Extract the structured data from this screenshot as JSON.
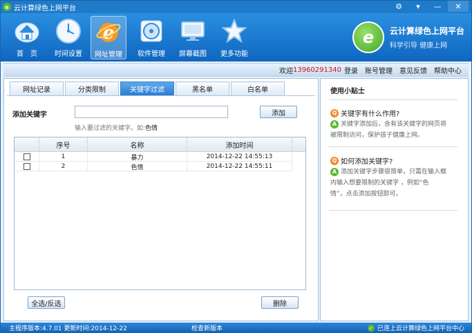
{
  "titlebar": {
    "title": "云计算绿色上网平台",
    "gear": "⚙",
    "dropdown": "▾",
    "minimize": "—",
    "close": "✕"
  },
  "toolbar": {
    "items": [
      {
        "label": "首　页",
        "icon": "home-icon"
      },
      {
        "label": "时间设置",
        "icon": "clock-icon"
      },
      {
        "label": "网址管理",
        "icon": "ie-icon"
      },
      {
        "label": "软件管理",
        "icon": "disc-icon"
      },
      {
        "label": "屏幕截图",
        "icon": "monitor-icon"
      },
      {
        "label": "更多功能",
        "icon": "star-icon"
      }
    ],
    "active_index": 2
  },
  "brand": {
    "title": "云计算绿色上网平台",
    "slogan": "科学引导  健康上网"
  },
  "userbar": {
    "welcome": "欢迎",
    "phone": "13960291340",
    "login": "登录",
    "account": "账号管理",
    "feedback": "意见反馈",
    "help": "帮助中心"
  },
  "tabs": [
    "网址记录",
    "分类限制",
    "关键字过滤",
    "黑名单",
    "白名单"
  ],
  "active_tab": 2,
  "form": {
    "label": "添加关键字",
    "value": "",
    "placeholder": "",
    "add_button": "添加",
    "hint_prefix": "输入要过滤的关键字。如:",
    "hint_example": "色情"
  },
  "table": {
    "headers": [
      "",
      "序号",
      "名称",
      "添加时间"
    ],
    "rows": [
      {
        "index": "1",
        "name": "暴力",
        "time": "2014-12-22 14:55:13"
      },
      {
        "index": "2",
        "name": "色情",
        "time": "2014-12-22 14:55:11"
      }
    ]
  },
  "buttons": {
    "select_all": "全选/反选",
    "delete": "删除"
  },
  "tips": {
    "title": "使用小贴士",
    "q1": "关键字有什么作用?",
    "a1_line1": "关键字添加后，含有该关键字的网页将",
    "a1_line2": "被限制访问，保护孩子健康上网。",
    "q2": "如何添加关键字?",
    "a2_line1": "添加关键字步骤很简单，只需在输入框",
    "a2_line2": "内输入想要限制的关键字 ，例如“色",
    "a2_line3": "情”，点击添加按钮即可。"
  },
  "status": {
    "version": "主程序版本:4.7.01 更新时间:2014-12-22",
    "check": "检查新版本",
    "connected": "已连上云计算绿色上网平台中心"
  },
  "colors": {
    "accent": "#1f7ac9",
    "active_tab": "#2b7dd1",
    "phone": "#d01616",
    "tip_q": "#f08a24",
    "tip_a": "#5cb82c"
  }
}
